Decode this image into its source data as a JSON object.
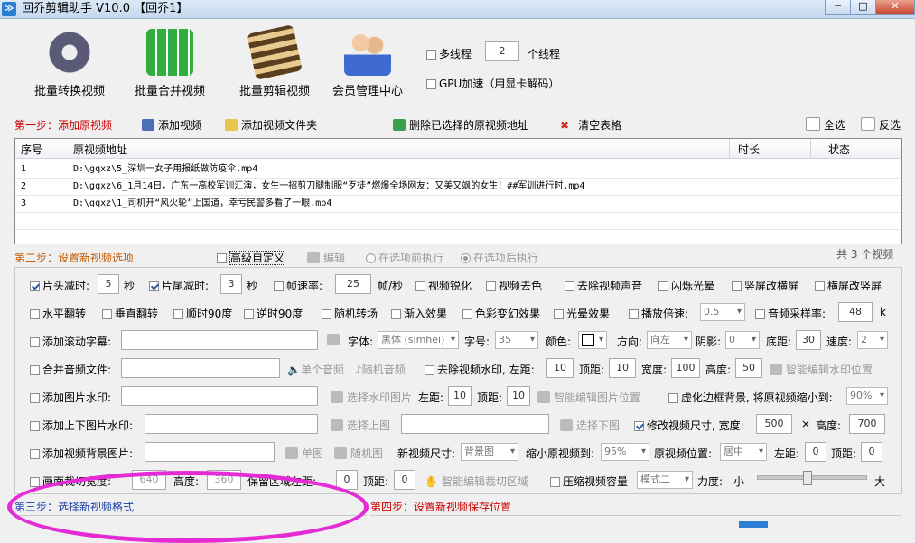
{
  "window": {
    "title": "回乔剪辑助手 V10.0 【回乔1】",
    "min": "─",
    "max": "□",
    "close": "✕"
  },
  "toolbar": [
    {
      "label": "批量转换视频",
      "icon": "film-reel-icon",
      "color": "#6b6b8a"
    },
    {
      "label": "批量合并视频",
      "icon": "merge-blocks-icon",
      "color": "#2fae3f"
    },
    {
      "label": "批量剪辑视频",
      "icon": "film-strip-icon",
      "color": "#8a6b3f"
    },
    {
      "label": "会员管理中心",
      "icon": "users-icon",
      "color": "#3f6bd0"
    }
  ],
  "thread": {
    "multi_label": "多线程",
    "count": "2",
    "unit": "个线程",
    "gpu_label": "GPU加速（用显卡解码）"
  },
  "step1": {
    "label": "第一步：添加原视频",
    "add_video": "添加视频",
    "add_folder": "添加视频文件夹",
    "delete_selected": "删除已选择的原视频地址",
    "clear_table": "清空表格",
    "select_all": "全选",
    "invert": "反选"
  },
  "table": {
    "headers": [
      "序号",
      "原视频地址",
      "时长",
      "状态"
    ],
    "rows": [
      {
        "no": "1",
        "path": "D:\\gqxz\\5_深圳一女子用报纸做防疫伞.mp4"
      },
      {
        "no": "2",
        "path": "D:\\gqxz\\6_1月14日，广东一高校军训汇演，女生一招剪刀腿制服“歹徒”燃爆全场网友：又美又飒的女生！##军训进行时.mp4"
      },
      {
        "no": "3",
        "path": "D:\\gqxz\\1_司机开“风火轮”上国道，幸亏民警多看了一眼.mp4"
      }
    ]
  },
  "step2": {
    "label": "第二步：设置新视频选项",
    "advanced": "高级自定义",
    "edit": "编辑",
    "before": "在选项前执行",
    "after": "在选项后执行",
    "count_text": "共 3 个视频"
  },
  "opts": {
    "head_cut": "片头减时:",
    "head_val": "5",
    "sec": "秒",
    "tail_cut": "片尾减时:",
    "tail_val": "3",
    "sec2": "秒",
    "fps": "帧速率:",
    "fps_val": "25",
    "fps_unit": "帧/秒",
    "sharpen": "视频锐化",
    "decolor": "视频去色",
    "mute": "去除视频声音",
    "flash": "闪烁光晕",
    "v2h": "竖屏改横屏",
    "h2v": "横屏改竖屏",
    "hflip": "水平翻转",
    "vflip": "垂直翻转",
    "cw90": "顺时90度",
    "ccw90": "逆时90度",
    "random_trans": "随机转场",
    "fade_in": "渐入效果",
    "color_fx": "色彩变幻效果",
    "halo": "光晕效果",
    "speed": "播放倍速:",
    "speed_val": "0.5",
    "sample": "音频采样率:",
    "sample_val": "48",
    "sample_unit": "k",
    "scroll_sub": "添加滚动字幕:",
    "font": "字体:",
    "font_val": "黑体 (simhei)",
    "size": "字号:",
    "size_val": "35",
    "color": "颜色:",
    "dir": "方向:",
    "dir_val": "向左",
    "shadow": "阴影:",
    "shadow_val": "0",
    "bottom": "底距:",
    "bottom_val": "30",
    "spd": "速度:",
    "spd_val": "2",
    "merge_audio": "合并音频文件:",
    "single_audio": "单个音频",
    "random_audio": "随机音频",
    "rm_watermark": "去除视频水印, 左距:",
    "wm_left": "10",
    "wm_top_l": "顶距:",
    "wm_top": "10",
    "wm_w_l": "宽度:",
    "wm_w": "100",
    "wm_h_l": "高度:",
    "wm_h": "50",
    "smart_wm": "智能编辑水印位置",
    "img_wm": "添加图片水印:",
    "choose_wm": "选择水印图片",
    "img_left_l": "左距:",
    "img_left": "10",
    "img_top_l": "顶距:",
    "img_top": "10",
    "smart_img": "智能编辑图片位置",
    "blur_bg": "虚化边框背景, 将原视频缩小到:",
    "blur_val": "90%",
    "updown_img": "添加上下图片水印:",
    "choose_up": "选择上图",
    "choose_down": "选择下图",
    "resize": "修改视频尺寸, 宽度:",
    "resize_w": "500",
    "times": "×",
    "resize_h_l": "高度:",
    "resize_h": "700",
    "bg_img": "添加视频背景图片:",
    "single_img": "单图",
    "random_img": "随机图",
    "new_size": "新视频尺寸:",
    "new_size_val": "背景图",
    "shrink": "缩小原视频到:",
    "shrink_val": "95%",
    "pos": "原视频位置:",
    "pos_val": "居中",
    "pos_left_l": "左距:",
    "pos_left": "0",
    "pos_top_l": "顶距:",
    "pos_top": "0",
    "crop": "画面裁切宽度:",
    "crop_w": "640",
    "crop_h_l": "高度:",
    "crop_h": "360",
    "crop_left_l": "保留区域左距:",
    "crop_left": "0",
    "crop_top_l": "顶距:",
    "crop_top": "0",
    "smart_crop": "智能编辑裁切区域",
    "compress": "压缩视频容量",
    "mode_val": "模式二",
    "force": "力度:",
    "small": "小",
    "big": "大"
  },
  "step3": {
    "label": "第三步：选择新视频格式"
  },
  "step4": {
    "label": "第四步：设置新视频保存位置"
  }
}
